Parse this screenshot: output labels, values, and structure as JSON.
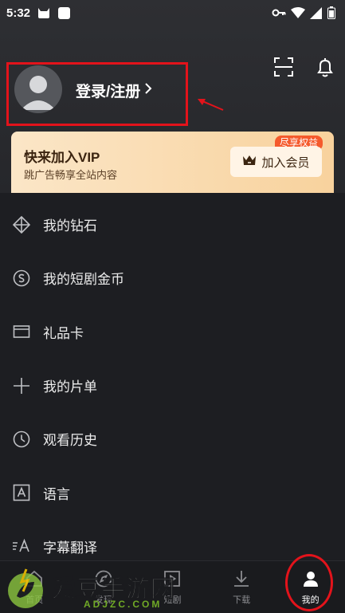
{
  "status_bar": {
    "time": "5:32"
  },
  "profile": {
    "login_label": "登录/注册"
  },
  "vip": {
    "title": "快来加入VIP",
    "subtitle": "跳广告畅享全站内容",
    "badge": "尽享权益",
    "button_label": "加入会员"
  },
  "menu": {
    "items": [
      {
        "label": "我的钻石",
        "icon": "diamond-icon"
      },
      {
        "label": "我的短剧金币",
        "icon": "coin-icon"
      },
      {
        "label": "礼品卡",
        "icon": "card-icon"
      },
      {
        "label": "我的片单",
        "icon": "plus-icon"
      },
      {
        "label": "观看历史",
        "icon": "clock-icon"
      },
      {
        "label": "语言",
        "icon": "language-icon"
      },
      {
        "label": "字幕翻译",
        "icon": "subtitle-translate-icon"
      }
    ]
  },
  "bottom_nav": {
    "items": [
      {
        "label": "首页",
        "icon": "home-icon"
      },
      {
        "label": "发现",
        "icon": "discover-icon"
      },
      {
        "label": "短剧",
        "icon": "short-drama-icon"
      },
      {
        "label": "下载",
        "icon": "download-icon"
      },
      {
        "label": "我的",
        "icon": "user-icon",
        "active": true
      }
    ]
  },
  "watermark": {
    "text": "爱豆手游网",
    "domain": "ADJZC.COM"
  },
  "colors": {
    "annotation_red": "#e3131b",
    "vip_gradient_start": "#fbe6c7",
    "vip_gradient_end": "#f8d29d",
    "badge": "#f55a2c",
    "background": "#1d1e22"
  }
}
